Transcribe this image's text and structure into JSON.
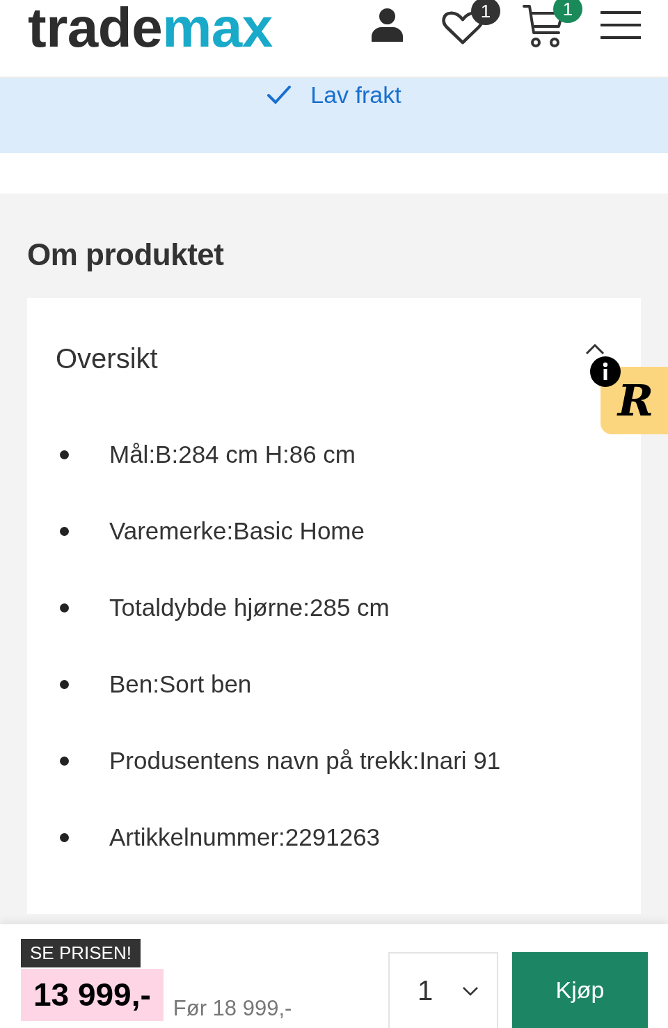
{
  "header": {
    "logo": [
      {
        "text": "trade",
        "color": "#2d2d2d"
      },
      {
        "text": "max",
        "color": "#19a9c9"
      }
    ],
    "icons": [
      {
        "kind": "account"
      },
      {
        "kind": "wishlist",
        "badge": "1"
      },
      {
        "kind": "cart",
        "badge": "1"
      },
      {
        "kind": "menu"
      }
    ]
  },
  "notice": {
    "text": "Lav frakt"
  },
  "product_info": {
    "title": "Om produktet",
    "accordion": {
      "title": "Oversikt",
      "expanded": true,
      "items": [
        "Mål:B:284 cm H:86 cm",
        "Varemerke:Basic Home",
        "Totaldybde hjørne:285 cm",
        "Ben:Sort ben",
        "Produsentens navn på trekk:Inari 91",
        "Artikkelnummer:2291263"
      ]
    }
  },
  "review_widget": {
    "letter": "R"
  },
  "price_bar": {
    "tag": "SE PRISEN!",
    "price": "13 999,-",
    "previous_price": "Før 18 999,-",
    "quantity": "1",
    "buy_button": "Kjøp"
  }
}
